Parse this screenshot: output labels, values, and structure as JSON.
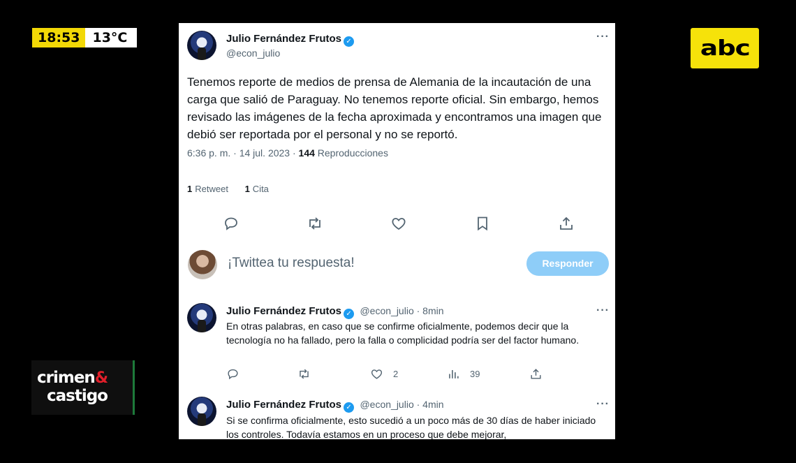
{
  "overlay": {
    "time": "18:53",
    "temperature": "13°C",
    "channel_logo": "abc",
    "program_logo_line1": "crimen",
    "program_logo_amp": "&",
    "program_logo_line2": "castigo"
  },
  "tweet": {
    "author": "Julio Fernández Frutos",
    "handle": "@econ_julio",
    "text": "Tenemos reporte de medios de prensa de Alemania de la incautación de una carga que salió de Paraguay. No tenemos reporte oficial. Sin embargo, hemos revisado las imágenes de la fecha aproximada y encontramos una imagen que debió ser reportada por el personal y no se reportó.",
    "time": "6:36 p. m. · 14 jul. 2023 · ",
    "views_count": "144",
    "views_label": "Reproducciones",
    "retweets_count": "1",
    "retweets_label": "Retweet",
    "quotes_count": "1",
    "quotes_label": "Cita",
    "more_icon": "more-icon"
  },
  "compose": {
    "placeholder": "¡Twittea tu respuesta!",
    "button": "Responder"
  },
  "replies": [
    {
      "author": "Julio Fernández Frutos",
      "handle": "@econ_julio · 8min",
      "text": "En otras palabras, en caso que se confirme oficialmente, podemos decir que la tecnología no ha fallado, pero la falla  o complicidad podría ser del factor humano.",
      "likes": "2",
      "views": "39"
    },
    {
      "author": "Julio Fernández Frutos",
      "handle": "@econ_julio · 4min",
      "text": "Si se confirma oficialmente, esto sucedió a un poco más de  30 días de haber iniciado los controles. Todavía estamos en un proceso que debe mejorar,"
    }
  ],
  "colors": {
    "accent": "#1d9bf0",
    "reply_button": "#8ecdf8",
    "clock_yellow": "#f2d806",
    "abc_yellow": "#f6e20a",
    "muted_text": "#536471"
  }
}
